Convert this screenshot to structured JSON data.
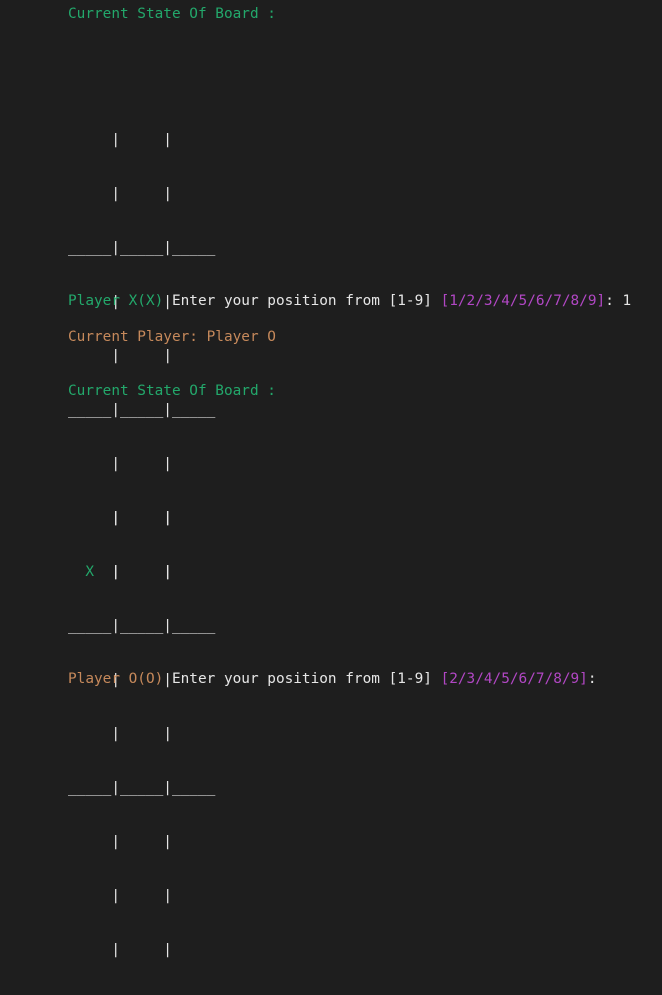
{
  "board_header": "Current State Of Board :",
  "board1": {
    "cells": [
      " ",
      " ",
      " ",
      " ",
      " ",
      " ",
      " ",
      " ",
      " "
    ]
  },
  "prompt1": {
    "player_label": "Player X(X)",
    "text": " Enter your position from [1-9] ",
    "options": "[1/2/3/4/5/6/7/8/9]",
    "suffix": ": 1"
  },
  "current_player": "Current Player: Player O",
  "board2": {
    "cells": [
      "X",
      " ",
      " ",
      " ",
      " ",
      " ",
      " ",
      " ",
      " "
    ]
  },
  "prompt2": {
    "player_label": "Player O(O)",
    "text": " Enter your position from [1-9] ",
    "options": "[2/3/4/5/6/7/8/9]",
    "suffix": ":"
  },
  "colors": {
    "background": "#1e1e1e",
    "header": "#23a86b",
    "player_x": "#23a86b",
    "player_o": "#c6895b",
    "options": "#b147c4",
    "text": "#e6e6e6"
  }
}
